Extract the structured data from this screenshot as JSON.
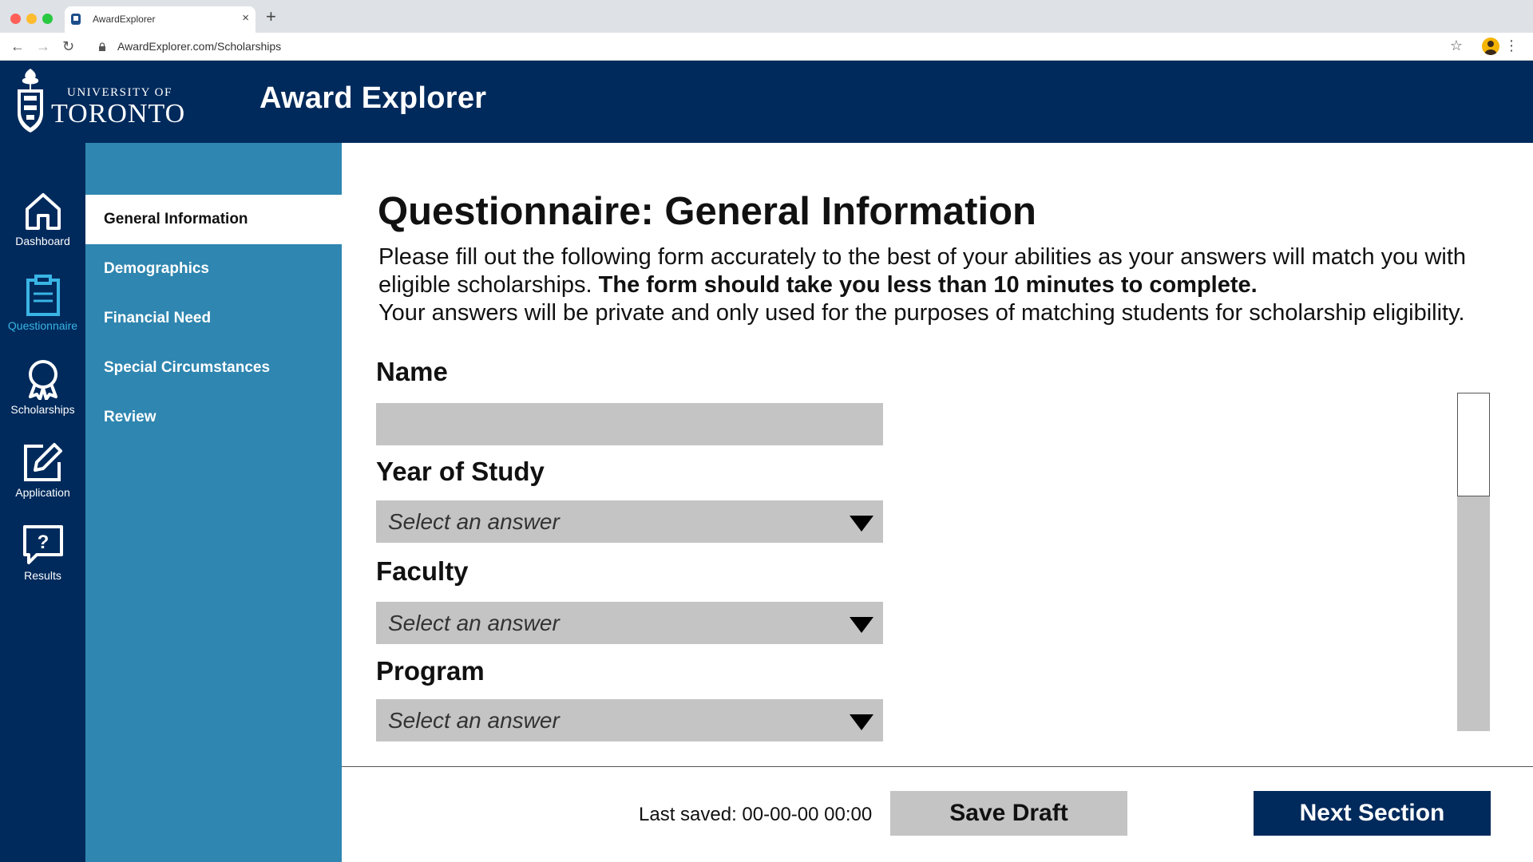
{
  "browser": {
    "tab_title": "AwardExplorer",
    "new_tab_label": "+",
    "url": "AwardExplorer.com/Scholarships"
  },
  "header": {
    "university_small": "UNIVERSITY OF",
    "university_big": "TORONTO",
    "app_title": "Award Explorer"
  },
  "rail": {
    "items": [
      {
        "label": "Dashboard",
        "icon": "home-icon"
      },
      {
        "label": "Questionnaire",
        "icon": "clipboard-icon",
        "active": true
      },
      {
        "label": "Scholarships",
        "icon": "award-icon"
      },
      {
        "label": "Application",
        "icon": "edit-icon"
      },
      {
        "label": "Results",
        "icon": "help-icon"
      }
    ]
  },
  "sections": {
    "items": [
      {
        "label": "General Information",
        "active": true
      },
      {
        "label": "Demographics"
      },
      {
        "label": "Financial Need"
      },
      {
        "label": "Special Circumstances"
      },
      {
        "label": "Review"
      }
    ]
  },
  "main": {
    "title": "Questionnaire: General Information",
    "intro_line1": "Please fill out the following form accurately to the best of your abilities as your answers will match you with",
    "intro_line2_plain": "eligible scholarships. ",
    "intro_line2_bold": "The form should take you less than 10 minutes to complete.",
    "intro_line3": "Your answers will be private and only used for the purposes of matching students for scholarship eligibility.",
    "fields": {
      "name_label": "Name",
      "name_value": "",
      "year_label": "Year of Study",
      "year_value": "Select an answer",
      "faculty_label": "Faculty",
      "faculty_value": "Select an answer",
      "program_label": "Program",
      "program_value": "Select an answer"
    }
  },
  "footer": {
    "last_saved": "Last saved: 00-00-00 00:00",
    "save_draft": "Save Draft",
    "next_section": "Next Section"
  },
  "colors": {
    "navy": "#002a5c",
    "section_blue": "#2f86b0",
    "active_accent": "#39b5e5",
    "input_gray": "#c4c4c4"
  }
}
